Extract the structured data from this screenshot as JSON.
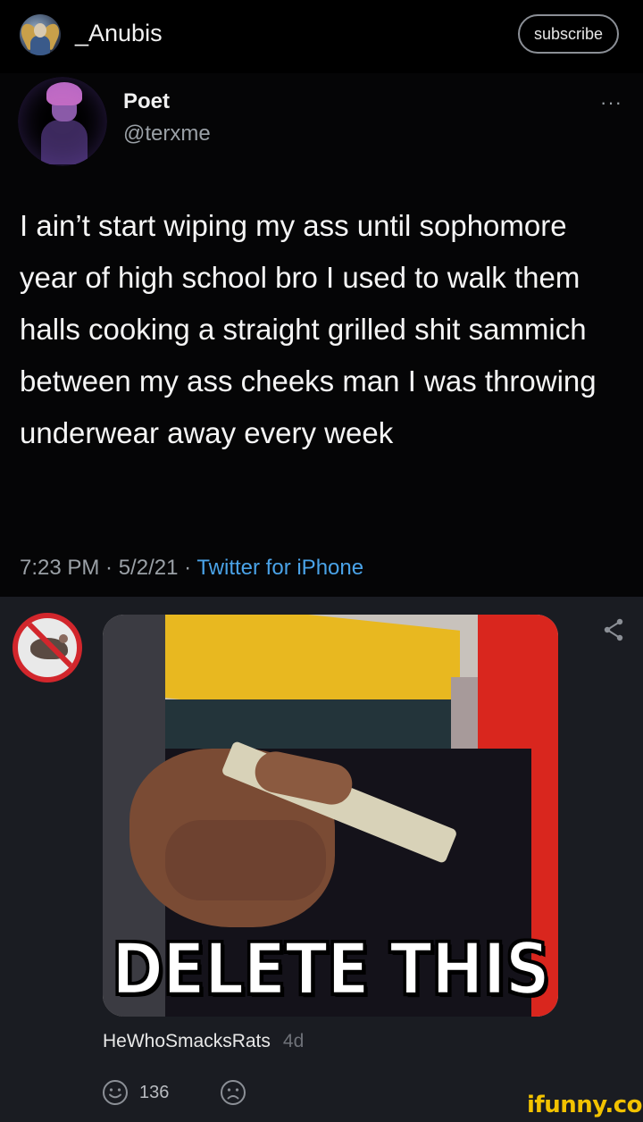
{
  "header": {
    "username": "_Anubis",
    "subscribe_label": "subscribe"
  },
  "tweet": {
    "display_name": "Poet",
    "handle": "@terxme",
    "more_label": "···",
    "text": "I ain’t start wiping my ass until sophomore year of high school bro I used to walk them halls cooking a straight grilled shit sammich between my ass cheeks man I was throwing underwear away every week",
    "timestamp": "7:23 PM · 5/2/21 · ",
    "source": "Twitter for iPhone"
  },
  "comment": {
    "meme_caption": "DELETE THIS",
    "username": "HeWhoSmacksRats",
    "age": "4d",
    "smile_count": "136"
  },
  "watermark": "ifunny.co",
  "colors": {
    "accent_blue": "#4aa3e8",
    "watermark_yellow": "#f2c200",
    "no_sign_red": "#d2262c"
  }
}
